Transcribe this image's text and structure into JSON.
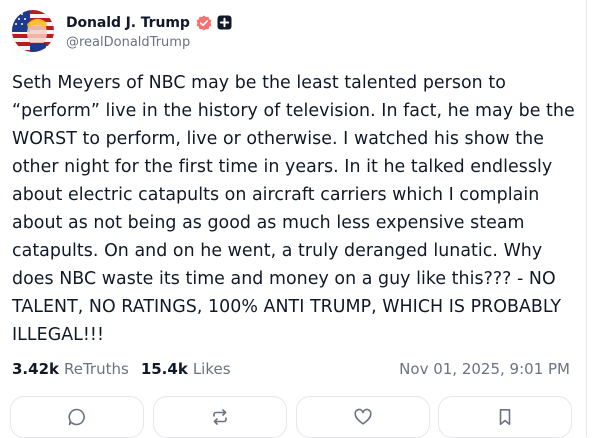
{
  "post": {
    "author": {
      "display_name": "Donald J. Trump",
      "handle": "@realDonaldTrump",
      "verified": true,
      "avatar_icon": "flag-portrait-avatar",
      "badge_icons": [
        "verified-badge-icon",
        "plus-badge-icon"
      ],
      "verified_color": "#f87171"
    },
    "text": "Seth Meyers of NBC may be the least talented person to “perform” live in the history of television. In fact, he may be the WORST to perform, live or otherwise. I watched his show the other night for the first time in years. In it he talked endlessly about electric catapults on aircraft carriers which I complain about as not being as good as much less expensive steam catapults. On and on he went, a truly deranged lunatic. Why does NBC waste its time and money on a guy like this??? - NO TALENT, NO RATINGS, 100% ANTI TRUMP, WHICH IS PROBABLY ILLEGAL!!!",
    "stats": {
      "retruths_count": "3.42k",
      "retruths_label": "ReTruths",
      "likes_count": "15.4k",
      "likes_label": "Likes"
    },
    "timestamp": "Nov 01, 2025, 9:01 PM",
    "actions": [
      {
        "name": "reply",
        "icon": "comment-icon"
      },
      {
        "name": "retruth",
        "icon": "retruth-icon"
      },
      {
        "name": "like",
        "icon": "heart-icon"
      },
      {
        "name": "bookmark",
        "icon": "bookmark-icon"
      }
    ]
  }
}
